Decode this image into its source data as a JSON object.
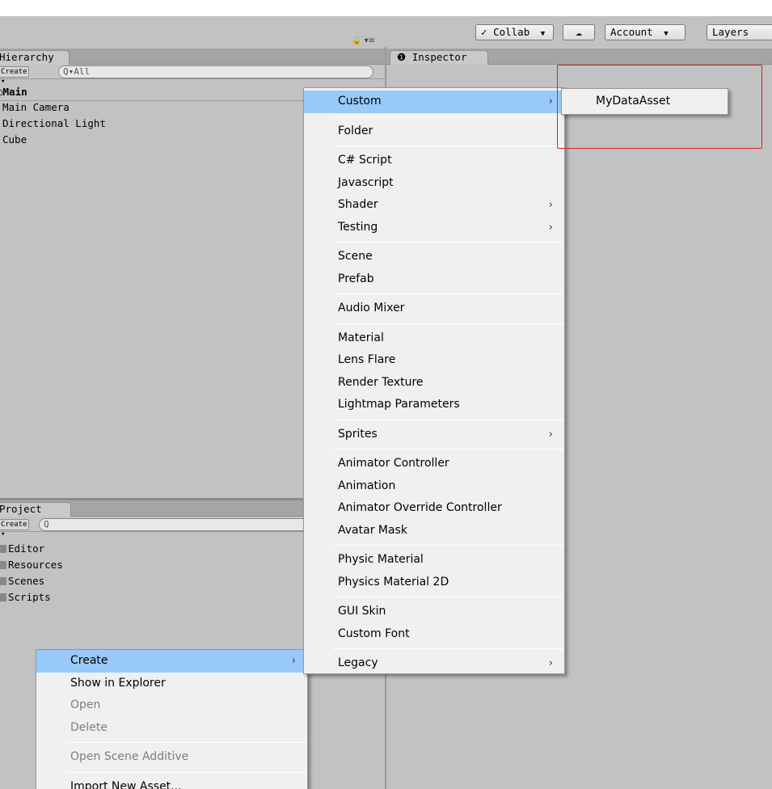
{
  "toolbar": {
    "collab": "Collab",
    "collab_icon": "check-circle-icon",
    "cloud_icon": "cloud-icon",
    "account": "Account",
    "layers": "Layers"
  },
  "hierarchy": {
    "tab": "Hierarchy",
    "create": "Create",
    "search_placeholder": "Q▾All",
    "scene": "Main",
    "items": [
      "Main Camera",
      "Directional Light",
      "Cube"
    ]
  },
  "inspector": {
    "tab": "Inspector"
  },
  "project": {
    "tab": "Project",
    "create": "Create",
    "search_placeholder": "Q",
    "folders": [
      "Editor",
      "Resources",
      "Scenes",
      "Scripts"
    ]
  },
  "context_menu": {
    "items": [
      "Create",
      "Show in Explorer",
      "Open",
      "Delete",
      "Open Scene Additive",
      "Import New Asset..."
    ]
  },
  "create_menu": {
    "groups": [
      [
        "Custom"
      ],
      [
        "Folder"
      ],
      [
        "C# Script",
        "Javascript",
        "Shader",
        "Testing"
      ],
      [
        "Scene",
        "Prefab"
      ],
      [
        "Audio Mixer"
      ],
      [
        "Material",
        "Lens Flare",
        "Render Texture",
        "Lightmap Parameters"
      ],
      [
        "Sprites"
      ],
      [
        "Animator Controller",
        "Animation",
        "Animator Override Controller",
        "Avatar Mask"
      ],
      [
        "Physic Material",
        "Physics Material 2D"
      ],
      [
        "GUI Skin",
        "Custom Font"
      ],
      [
        "Legacy"
      ]
    ]
  },
  "custom_submenu": {
    "items": [
      "MyDataAsset"
    ]
  },
  "colors": {
    "highlight": "#99c9f8",
    "annotation_box": "#e02020"
  }
}
